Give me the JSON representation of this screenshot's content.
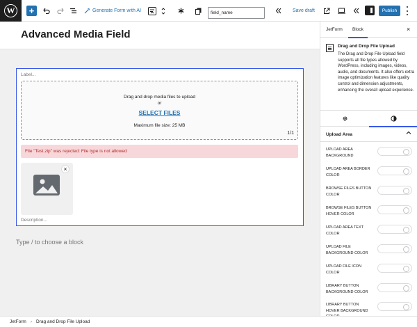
{
  "toolbar": {
    "wp_logo": "W",
    "generate_form": "Generate Form with AI",
    "field_input_value": "field_name",
    "save_draft": "Save draft",
    "publish": "Publish"
  },
  "editor": {
    "page_title": "Advanced Media Field",
    "block_placeholder": "Type / to choose a block"
  },
  "media_block": {
    "label": "Label...",
    "drop_text": "Drag and drop media files to upload",
    "or_text": "or",
    "select_files": "SELECT FILES",
    "max_size": "Maximum file size: 25 MB",
    "file_count": "1/1",
    "error": "File \"Test.zip\" was rejected: File type is not allowed",
    "remove": "×",
    "description": "Description..."
  },
  "sidebar": {
    "tabs": [
      "JetForm",
      "Block"
    ],
    "active_tab": "Block",
    "close": "×",
    "block_title": "Drag and Drop File Upload",
    "block_description": "The Drag and Drop File Upload field supports all file types allowed by WordPress, including images, videos, audio, and documents. It also offers extra image optimization features like quality control and dimension adjustments, enhancing the overall upload experience.",
    "style_tabs": [
      "settings-gear-icon",
      "styles-contrast-icon"
    ],
    "panel_title": "Upload Area",
    "options": [
      "Upload Area Background",
      "Upload Area Border Color",
      "Browse Files Button Color",
      "Browse Files Button Hover Color",
      "Upload Area Text Color",
      "Upload File Background Color",
      "Upload File Icon Color",
      "Library Button Background Color",
      "Library Button Hover Background Color"
    ]
  },
  "breadcrumb": [
    "JetForm",
    "Drag and Drop File Upload"
  ],
  "colors": {
    "accent": "#3858e9",
    "link": "#2271b1",
    "error_bg": "#f8d7da",
    "error_text": "#b32d2e"
  }
}
